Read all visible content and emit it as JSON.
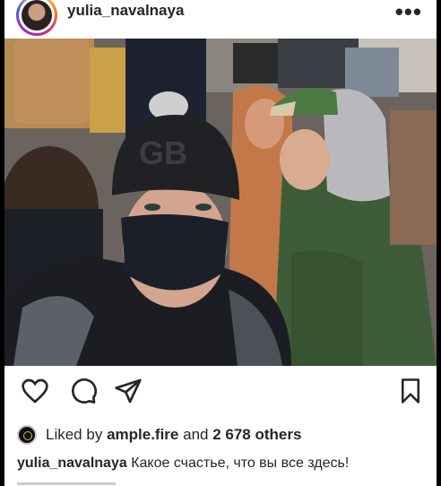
{
  "post": {
    "username": "yulia_navalnaya",
    "more_label": "•••",
    "likes": {
      "prefix": "Liked by",
      "liker": "ample.fire",
      "middle": "and",
      "others": "2 678 others"
    },
    "caption": {
      "username": "yulia_navalnaya",
      "text": "Какое счастье, что вы все здесь!"
    }
  },
  "icons": {
    "like": "heart-icon",
    "comment": "comment-icon",
    "share": "send-icon",
    "save": "bookmark-icon",
    "more": "more-options-icon"
  },
  "colors": {
    "text": "#262626",
    "background": "#ffffff",
    "frame": "#000000"
  }
}
